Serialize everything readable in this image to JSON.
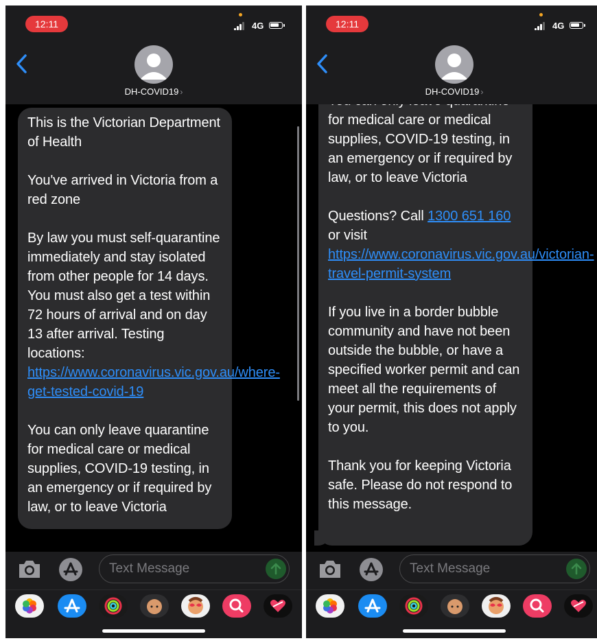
{
  "status": {
    "time": "12:11",
    "network": "4G"
  },
  "contact": {
    "name": "DH-COVID19",
    "chevron": "›"
  },
  "compose": {
    "placeholder": "Text Message"
  },
  "icons": {
    "back": "back-chevron-icon",
    "avatar": "person-icon",
    "camera": "camera-icon",
    "apps": "app-store-icon",
    "send": "send-arrow-icon",
    "tray": [
      "photos-icon",
      "app-store-icon",
      "activity-rings-icon",
      "memoji-icon",
      "memoji-stickers-icon",
      "image-search-icon",
      "digital-touch-icon"
    ]
  },
  "colors": {
    "bubble": "#2c2c2e",
    "link": "#2e8ef9",
    "time_pill": "#e5393c",
    "header": "#1c1c1e"
  },
  "screens": {
    "left": {
      "p1": "This is the Victorian Department of Health",
      "p2": "You've arrived in Victoria from a red zone",
      "p3_text": "By law you must self-quarantine immediately and stay isolated from other people for 14 days. You must also get a test within 72 hours of arrival and on day 13 after arrival. Testing locations: ",
      "p3_link": "https://www.coronavirus.vic.gov.au/where-get-tested-covid-19",
      "p4": "You can only leave quarantine for medical care or medical supplies, COVID-19 testing, in an emergency or if required by law, or to leave Victoria"
    },
    "right": {
      "p1": "You can only leave quarantine for medical care or medical supplies, COVID-19 testing, in an emergency or if required by law, or to leave Victoria",
      "p2_a": "Questions? Call ",
      "p2_phone": "1300 651 160",
      "p2_b": " or visit ",
      "p2_link": "https://www.coronavirus.vic.gov.au/victorian-travel-permit-system",
      "p3": "If you live in a border bubble community and have not been outside the bubble, or have a specified worker permit and can meet all the requirements of your permit, this does not apply to you.",
      "p4": "Thank you for keeping Victoria safe. Please do not respond to this message."
    }
  }
}
